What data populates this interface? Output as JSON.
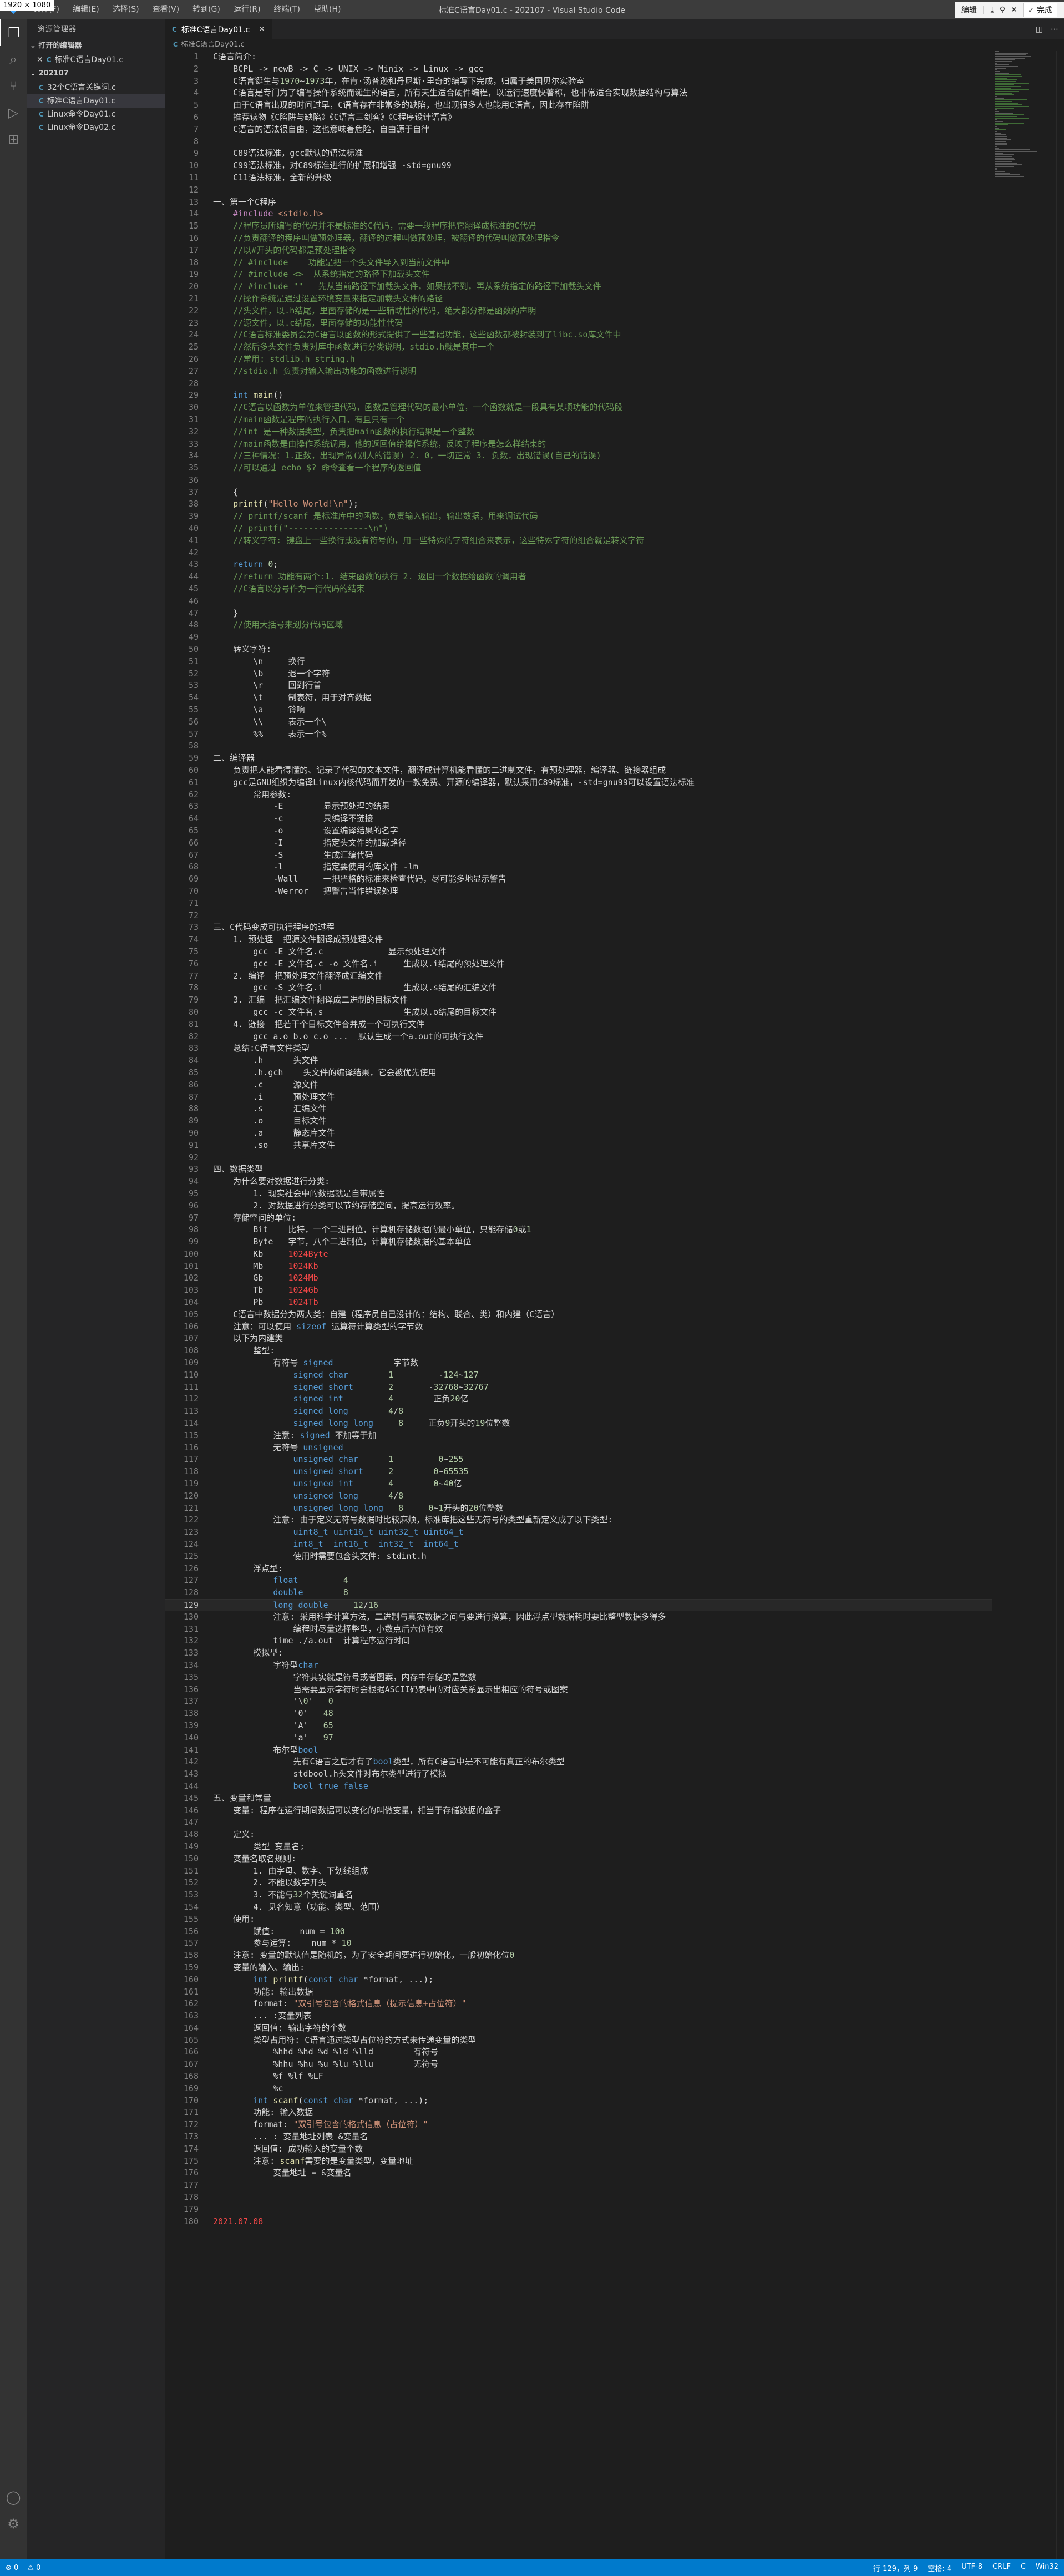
{
  "window": {
    "title": "标准C语言Day01.c - 202107 - Visual Studio Code",
    "menu": [
      "文件(F)",
      "编辑(E)",
      "选择(S)",
      "查看(V)",
      "转到(G)",
      "运行(R)",
      "终端(T)",
      "帮助(H)"
    ],
    "screenshot_tool": {
      "edit": "编辑",
      "done": "完成"
    },
    "dimension_overlay": "1920 × 1080"
  },
  "sidebar": {
    "title": "资源管理器",
    "open_editors_label": "打开的编辑器",
    "open_editors": [
      {
        "name": "标准C语言Day01.c",
        "path": ""
      }
    ],
    "folder_label": "202107",
    "files": [
      {
        "name": "32个C语言关键词.c"
      },
      {
        "name": "标准C语言Day01.c"
      },
      {
        "name": "Linux命令Day01.c"
      },
      {
        "name": "Linux命令Day02.c"
      }
    ]
  },
  "editor": {
    "tab_label": "标准C语言Day01.c",
    "breadcrumb": "标准C语言Day01.c",
    "current_line": 129,
    "lines": [
      "C语言简介:",
      "    BCPL -> newB -> C -> UNIX -> Minix -> Linux -> gcc",
      "    C语言诞生与1970~1973年，在肯·汤普逊和丹尼斯·里奇的编写下完成，归属于美国贝尔实验室",
      "    C语言是专门为了编写操作系统而诞生的语言，所有天生适合硬件编程，以运行速度快著称，也非常适合实现数据结构与算法",
      "    由于C语言出现的时间过早，C语言存在非常多的缺陷，也出现很多人也能用C语言，因此存在陷阱",
      "    推荐读物《C陷阱与缺陷》《C语言三剑客》《C程序设计语言》",
      "    C语言的语法很自由，这也意味着危险，自由源于自律",
      "",
      "    C89语法标准，gcc默认的语法标准",
      "    C99语法标准，对C89标准进行的扩展和增强 -std=gnu99",
      "    C11语法标准，全新的升级",
      "",
      "一、第一个C程序",
      "    #include <stdio.h>",
      "    //程序员所编写的代码并不是标准的C代码，需要一段程序把它翻译成标准的C代码",
      "    //负责翻译的程序叫做预处理器，翻译的过程叫做预处理，被翻译的代码叫做预处理指令",
      "    //以#开头的代码都是预处理指令",
      "    // #include    功能是把一个头文件导入到当前文件中",
      "    // #include <>  从系统指定的路径下加载头文件",
      "    // #include \"\"   先从当前路径下加载头文件，如果找不到，再从系统指定的路径下加载头文件",
      "    //操作系统是通过设置环境变量来指定加载头文件的路径",
      "    //头文件，以.h结尾，里面存储的是一些辅助性的代码，绝大部分都是函数的声明",
      "    //源文件，以.c结尾，里面存储的功能性代码",
      "    //C语言标准委员会为C语言以函数的形式提供了一些基础功能，这些函数都被封装到了libc.so库文件中",
      "    //然后多头文件负责对库中函数进行分类说明，stdio.h就是其中一个",
      "    //常用: stdlib.h string.h",
      "    //stdio.h 负责对输入输出功能的函数进行说明",
      "",
      "    int main()",
      "    //C语言以函数为单位来管理代码，函数是管理代码的最小单位，一个函数就是一段具有某项功能的代码段",
      "    //main函数是程序的执行入口，有且只有一个",
      "    //int 是一种数据类型，负责把main函数的执行结果是一个整数",
      "    //main函数是由操作系统调用，他的返回值给操作系统，反映了程序是怎么样结束的",
      "    //三种情况：1.正数，出现异常(别人的错误) 2. 0，一切正常 3. 负数，出现错误(自己的错误)",
      "    //可以通过 echo $? 命令查看一个程序的返回值",
      "",
      "    {",
      "    printf(\"Hello World!\\n\");",
      "    // printf/scanf 是标准库中的函数，负责输入输出，输出数据，用来调试代码",
      "    // printf(\"----------------\\n\")",
      "    //转义字符: 键盘上一些换行或没有符号的，用一些特殊的字符组合来表示，这些特殊字符的组合就是转义字符",
      "",
      "    return 0;",
      "    //return 功能有两个:1. 结束函数的执行 2. 返回一个数据给函数的调用者",
      "    //C语言以分号作为一行代码的结束",
      "",
      "    }",
      "    //使用大括号来划分代码区域",
      "",
      "    转义字符:",
      "        \\n     换行",
      "        \\b     退一个字符",
      "        \\r     回到行首",
      "        \\t     制表符，用于对齐数据",
      "        \\a     铃响",
      "        \\\\     表示一个\\",
      "        %%     表示一个%",
      "",
      "二、编译器",
      "    负责把人能看得懂的、记录了代码的文本文件，翻译成计算机能看懂的二进制文件，有预处理器，编译器、链接器组成",
      "    gcc是GNU组织为编译Linux内核代码而开发的一款免费、开源的编译器，默认采用C89标准，-std=gnu99可以设置语法标准",
      "        常用参数:",
      "            -E        显示预处理的结果",
      "            -c        只编译不链接",
      "            -o        设置编译结果的名字",
      "            -I        指定头文件的加载路径",
      "            -S        生成汇编代码",
      "            -l        指定要使用的库文件 -lm",
      "            -Wall     一把严格的标准来检查代码，尽可能多地显示警告",
      "            -Werror   把警告当作错误处理",
      "",
      "",
      "三、C代码变成可执行程序的过程",
      "    1. 预处理  把源文件翻译成预处理文件",
      "        gcc -E 文件名.c             显示预处理文件",
      "        gcc -E 文件名.c -o 文件名.i     生成以.i结尾的预处理文件",
      "    2. 编译  把预处理文件翻译成汇编文件",
      "        gcc -S 文件名.i                生成以.s结尾的汇编文件",
      "    3. 汇编  把汇编文件翻译成二进制的目标文件",
      "        gcc -c 文件名.s                生成以.o结尾的目标文件",
      "    4. 链接  把若干个目标文件合并成一个可执行文件",
      "        gcc a.o b.o c.o ...  默认生成一个a.out的可执行文件",
      "    总结:C语言文件类型",
      "        .h      头文件",
      "        .h.gch    头文件的编译结果，它会被优先使用",
      "        .c      源文件",
      "        .i      预处理文件",
      "        .s      汇编文件",
      "        .o      目标文件",
      "        .a      静态库文件",
      "        .so     共享库文件",
      "",
      "四、数据类型",
      "    为什么要对数据进行分类:",
      "        1. 现实社会中的数据就是自带属性",
      "        2. 对数据进行分类可以节约存储空间，提高运行效率。",
      "    存储空间的单位:",
      "        Bit    比特，一个二进制位，计算机存储数据的最小单位，只能存储0或1",
      "        Byte   字节，八个二进制位，计算机存储数据的基本单位",
      "        Kb     1024Byte",
      "        Mb     1024Kb",
      "        Gb     1024Mb",
      "        Tb     1024Gb",
      "        Pb     1024Tb",
      "    C语言中数据分为两大类：自建（程序员自己设计的：结构、联合、类）和内建（C语言）",
      "    注意：可以使用 sizeof 运算符计算类型的字节数",
      "    以下为内建类",
      "        整型:",
      "            有符号 signed            字节数",
      "                signed char        1         -124~127",
      "                signed short       2       -32768~32767",
      "                signed int         4        正负20亿",
      "                signed long        4/8",
      "                signed long long     8     正负9开头的19位整数",
      "            注意: signed 不加等于加",
      "            无符号 unsigned",
      "                unsigned char      1         0~255",
      "                unsigned short     2        0~65535",
      "                unsigned int       4        0~40亿",
      "                unsigned long      4/8",
      "                unsigned long long   8     0~1开头的20位整数",
      "            注意: 由于定义无符号数据时比较麻烦，标准库把这些无符号的类型重新定义成了以下类型:",
      "                uint8_t uint16_t uint32_t uint64_t",
      "                int8_t  int16_t  int32_t  int64_t",
      "                使用时需要包含头文件: stdint.h",
      "        浮点型:",
      "            float         4",
      "            double        8",
      "            long double     12/16",
      "            注意: 采用科学计算方法，二进制与真实数据之间与要进行换算，因此浮点型数据耗时要比整型数据多得多",
      "                编程时尽量选择整型，小数点后六位有效",
      "            time ./a.out  计算程序运行时间",
      "        模拟型:",
      "            字符型char",
      "                字符其实就是符号或者图案，内存中存储的是整数",
      "                当需要显示字符时会根据ASCII码表中的对应关系显示出相应的符号或图案",
      "                '\\0'   0",
      "                '0'   48",
      "                'A'   65",
      "                'a'   97",
      "            布尔型bool",
      "                先有C语言之后才有了bool类型，所有C语言中是不可能有真正的布尔类型",
      "                stdbool.h头文件对布尔类型进行了模拟",
      "                bool true false",
      "五、变量和常量",
      "    变量: 程序在运行期间数据可以变化的叫做变量，相当于存储数据的盒子",
      "",
      "    定义:",
      "        类型 变量名;",
      "    变量名取名规则:",
      "        1. 由字母、数字、下划线组成",
      "        2. 不能以数字开头",
      "        3. 不能与32个关键词重名",
      "        4. 见名知意（功能、类型、范围）",
      "    使用:",
      "        赋值:     num = 100",
      "        参与运算:    num * 10",
      "    注意: 变量的默认值是随机的，为了安全期间要进行初始化，一般初始化位0",
      "    变量的输入、输出:",
      "        int printf(const char *format, ...);",
      "        功能: 输出数据",
      "        format: \"双引号包含的格式信息（提示信息+占位符）\"",
      "        ... :变量列表",
      "        返回值: 输出字符的个数",
      "        类型占用符: C语言通过类型占位符的方式来传递变量的类型",
      "            %hhd %hd %d %ld %lld        有符号",
      "            %hhu %hu %u %lu %llu        无符号",
      "            %f %lf %LF",
      "            %c",
      "        int scanf(const char *format, ...);",
      "        功能: 输入数据",
      "        format: \"双引号包含的格式信息（占位符）\"",
      "        ... : 变量地址列表 &变量名",
      "        返回值: 成功输入的变量个数",
      "        注意: scanf需要的是变量类型，变量地址",
      "            变量地址 = &变量名",
      "",
      "",
      "",
      "2021.07.08"
    ]
  },
  "statusbar": {
    "left": [
      "⊗ 0",
      "⚠ 0"
    ],
    "right": [
      "行 129，列 9",
      "空格: 4",
      "UTF-8",
      "CRLF",
      "C",
      "Win32"
    ]
  }
}
